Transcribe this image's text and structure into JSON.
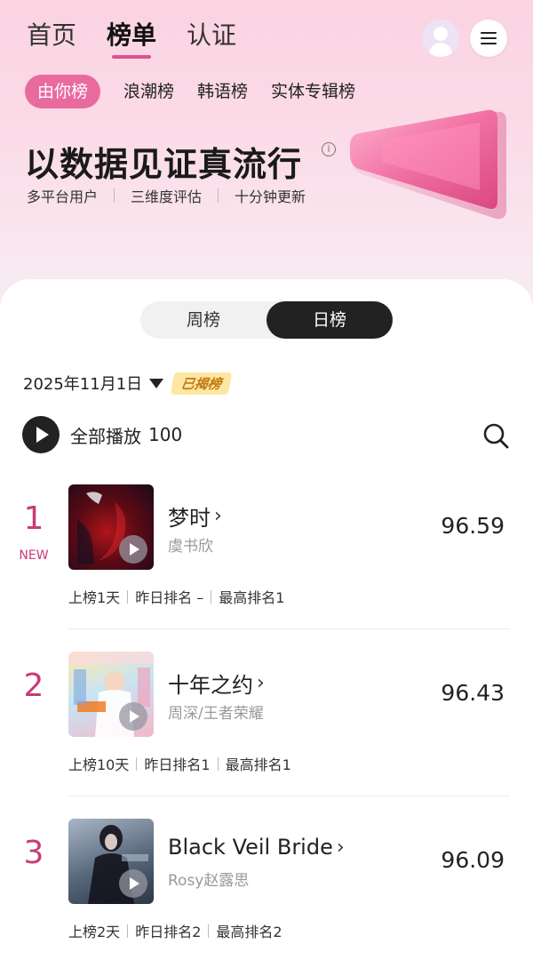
{
  "top_nav": {
    "tabs": [
      "首页",
      "榜单",
      "认证"
    ],
    "active_index": 1
  },
  "sub_nav": {
    "chips": [
      "由你榜",
      "浪潮榜",
      "韩语榜",
      "实体专辑榜"
    ],
    "active_index": 0
  },
  "hero": {
    "slogan": "以数据见证真流行",
    "info_icon": "info-circle-icon",
    "features": [
      "多平台用户",
      "三维度评估",
      "十分钟更新"
    ]
  },
  "period_toggle": {
    "options": [
      "周榜",
      "日榜"
    ],
    "active_index": 1
  },
  "date_bar": {
    "date": "2025年11月1日",
    "status_badge": "已揭榜"
  },
  "play_all": {
    "label": "全部播放",
    "count": "100"
  },
  "colors": {
    "accent": "#c83b7a",
    "chip_active": "#e96b9e",
    "dark": "#222222",
    "badge_bg": "#fde7a3"
  },
  "songs": [
    {
      "rank": "1",
      "new_tag": "NEW",
      "title": "梦时",
      "artist": "虞书欣",
      "score": "96.59",
      "meta": [
        "上榜1天",
        "昨日排名 –",
        "最高排名1"
      ]
    },
    {
      "rank": "2",
      "new_tag": "",
      "title": "十年之约",
      "artist": "周深/王者荣耀",
      "score": "96.43",
      "meta": [
        "上榜10天",
        "昨日排名1",
        "最高排名1"
      ]
    },
    {
      "rank": "3",
      "new_tag": "",
      "title": "Black Veil Bride",
      "artist": "Rosy赵露思",
      "score": "96.09",
      "meta": [
        "上榜2天",
        "昨日排名2",
        "最高排名2"
      ]
    }
  ]
}
